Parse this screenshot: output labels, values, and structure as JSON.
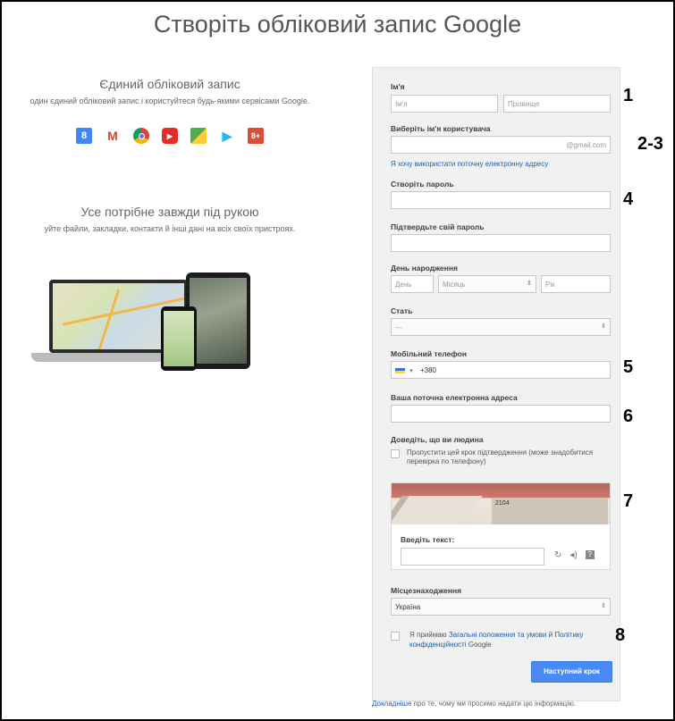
{
  "title": "Створіть обліковий запис Google",
  "left": {
    "heading1": "Єдиний обліковий запис",
    "text1": "один єдиний обліковий запис і користуйтеся будь-якими сервісами Google.",
    "icons": [
      {
        "name": "google-search-icon",
        "glyph": "8",
        "bg": "#4285f4"
      },
      {
        "name": "gmail-icon",
        "glyph": "M",
        "bg": "#ffffff"
      },
      {
        "name": "chrome-icon",
        "glyph": "●",
        "bg": "#ffffff"
      },
      {
        "name": "youtube-icon",
        "glyph": "▶",
        "bg": "#e52d27"
      },
      {
        "name": "maps-icon",
        "glyph": "◆",
        "bg": "#ffffff"
      },
      {
        "name": "play-icon",
        "glyph": "▶",
        "bg": "#ffffff"
      },
      {
        "name": "google-plus-icon",
        "glyph": "8+",
        "bg": "#dd4b39"
      }
    ],
    "heading2": "Усе потрібне завжди під рукою",
    "text2": "уйте файли, закладки, контакти й інші дані на всіх своїх пристроях."
  },
  "form": {
    "name_label": "Ім'я",
    "first_placeholder": "Ім'я",
    "last_placeholder": "Прізвище",
    "username_label": "Виберіть ім'я користувача",
    "gmail_suffix": "@gmail.com",
    "use_current_email_link": "Я хочу використати поточну електронну адресу",
    "password_label": "Створіть пароль",
    "confirm_label": "Підтвердьте свій пароль",
    "birthday_label": "День народження",
    "day_placeholder": "День",
    "month_placeholder": "Місяць",
    "year_placeholder": "Рік",
    "gender_label": "Стать",
    "gender_value": "---",
    "phone_label": "Мобільний телефон",
    "phone_code": "+380",
    "email_label": "Ваша поточна електронна адреса",
    "human_label": "Доведіть, що ви людина",
    "skip_check": "Пропустити цей крок підтвердження (може знадобитися перевірка по телефону)",
    "captcha_number": "2104",
    "captcha_text_label": "Введіть текст:",
    "location_label": "Місцезнаходження",
    "location_value": "Україна",
    "accept_prefix": "Я приймаю",
    "terms_link": "Загальні положення та умови",
    "accept_and": "й",
    "privacy_link": "Політику конфіденційності",
    "accept_suffix": "Google",
    "next_button": "Наступний крок"
  },
  "footnote": {
    "link": "Докладніше",
    "text": "про те, чому ми просимо надати цю інформацію."
  },
  "annotations": [
    "1",
    "2-3",
    "4",
    "5",
    "6",
    "7",
    "8"
  ]
}
